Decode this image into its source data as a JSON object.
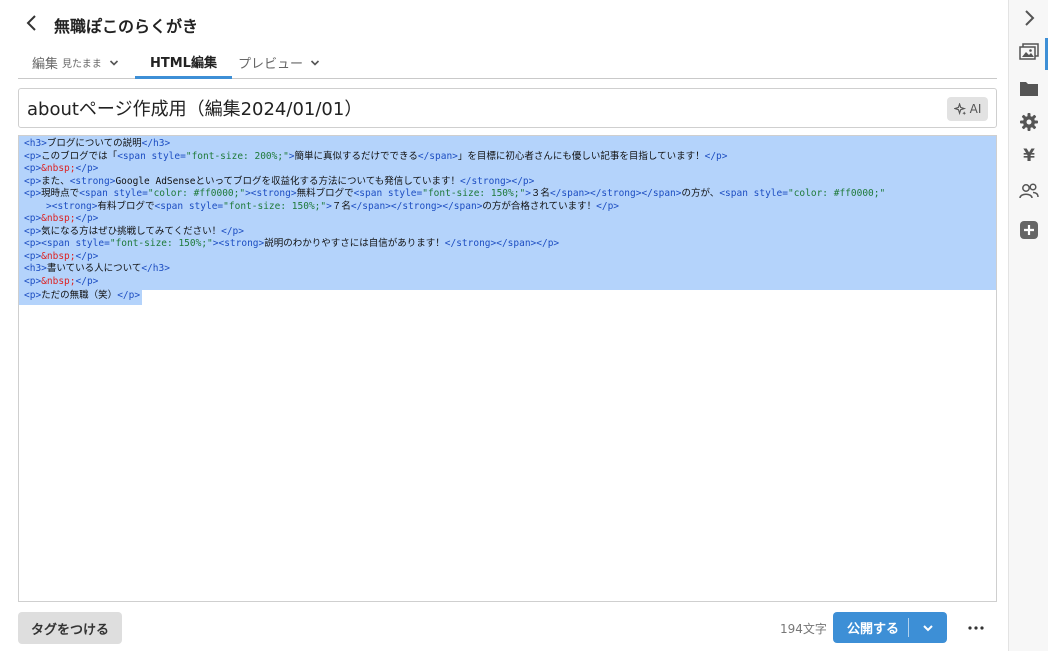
{
  "header": {
    "blog_title": "無職ぽこのらくがき"
  },
  "tabs": {
    "edit": {
      "label": "編集",
      "sub": "見たまま"
    },
    "html": {
      "label": "HTML編集"
    },
    "preview": {
      "label": "プレビュー"
    }
  },
  "title": {
    "value": "aboutページ作成用（編集2024/01/01）",
    "ai_label": "AI"
  },
  "editor": {
    "selected": true,
    "lines": [
      [
        [
          "t",
          "<h3>"
        ],
        [
          "x",
          "ブログについての説明"
        ],
        [
          "t",
          "</h3>"
        ]
      ],
      [
        [
          "t",
          "<p>"
        ],
        [
          "x",
          "このブログでは「"
        ],
        [
          "t",
          "<span "
        ],
        [
          "a",
          "style="
        ],
        [
          "v",
          "\"font-size: 200%;\""
        ],
        [
          "t",
          ">"
        ],
        [
          "x",
          "簡単に真似するだけでできる"
        ],
        [
          "t",
          "</span>"
        ],
        [
          "x",
          "」を目標に初心者さんにも優しい記事を目指しています！"
        ],
        [
          "t",
          "</p>"
        ]
      ],
      [
        [
          "t",
          "<p>"
        ],
        [
          "d",
          "&nbsp;"
        ],
        [
          "t",
          "</p>"
        ]
      ],
      [
        [
          "t",
          "<p>"
        ],
        [
          "x",
          "また、"
        ],
        [
          "t",
          "<strong>"
        ],
        [
          "x",
          "Google AdSenseといってブログを収益化する方法についても発信しています！"
        ],
        [
          "t",
          "</strong></p>"
        ]
      ],
      [
        [
          "t",
          "<p>"
        ],
        [
          "x",
          "現時点で"
        ],
        [
          "t",
          "<span "
        ],
        [
          "a",
          "style="
        ],
        [
          "v",
          "\"color: #ff0000;\""
        ],
        [
          "t",
          "><strong>"
        ],
        [
          "x",
          "無料ブログで"
        ],
        [
          "t",
          "<span "
        ],
        [
          "a",
          "style="
        ],
        [
          "v",
          "\"font-size: 150%;\""
        ],
        [
          "t",
          ">"
        ],
        [
          "x",
          "３名"
        ],
        [
          "t",
          "</span></strong></span>"
        ],
        [
          "x",
          "の方が、"
        ],
        [
          "t",
          "<span "
        ],
        [
          "a",
          "style="
        ],
        [
          "v",
          "\"color: #ff0000;\""
        ]
      ],
      [
        [
          "t",
          "><strong>"
        ],
        [
          "x",
          "有料ブログで"
        ],
        [
          "t",
          "<span "
        ],
        [
          "a",
          "style="
        ],
        [
          "v",
          "\"font-size: 150%;\""
        ],
        [
          "t",
          ">"
        ],
        [
          "x",
          "７名"
        ],
        [
          "t",
          "</span></strong></span>"
        ],
        [
          "x",
          "の方が合格されています！"
        ],
        [
          "t",
          "</p>"
        ]
      ],
      [
        [
          "t",
          "<p>"
        ],
        [
          "d",
          "&nbsp;"
        ],
        [
          "t",
          "</p>"
        ]
      ],
      [
        [
          "t",
          "<p>"
        ],
        [
          "x",
          "気になる方はぜひ挑戦してみてください！"
        ],
        [
          "t",
          "</p>"
        ]
      ],
      [
        [
          "t",
          "<p><span "
        ],
        [
          "a",
          "style="
        ],
        [
          "v",
          "\"font-size: 150%;\""
        ],
        [
          "t",
          "><strong>"
        ],
        [
          "x",
          "説明のわかりやすさには自信があります！"
        ],
        [
          "t",
          "</strong></span></p>"
        ]
      ],
      [
        [
          "t",
          "<p>"
        ],
        [
          "d",
          "&nbsp;"
        ],
        [
          "t",
          "</p>"
        ]
      ],
      [
        [
          "t",
          "<h3>"
        ],
        [
          "x",
          "書いている人について"
        ],
        [
          "t",
          "</h3>"
        ]
      ],
      [
        [
          "t",
          "<p>"
        ],
        [
          "d",
          "&nbsp;"
        ],
        [
          "t",
          "</p>"
        ]
      ],
      [
        [
          "t",
          "<p>"
        ],
        [
          "x",
          "ただの無職（笑）"
        ],
        [
          "t",
          "</p>"
        ]
      ]
    ]
  },
  "footer": {
    "tag_label": "タグをつける",
    "char_count": "194文字",
    "publish_label": "公開する"
  },
  "sidebar": {
    "items": [
      "chevron-right-icon",
      "image-icon",
      "folder-icon",
      "gear-icon",
      "yen-icon",
      "users-icon",
      "plus-icon"
    ],
    "yen_glyph": "¥"
  }
}
